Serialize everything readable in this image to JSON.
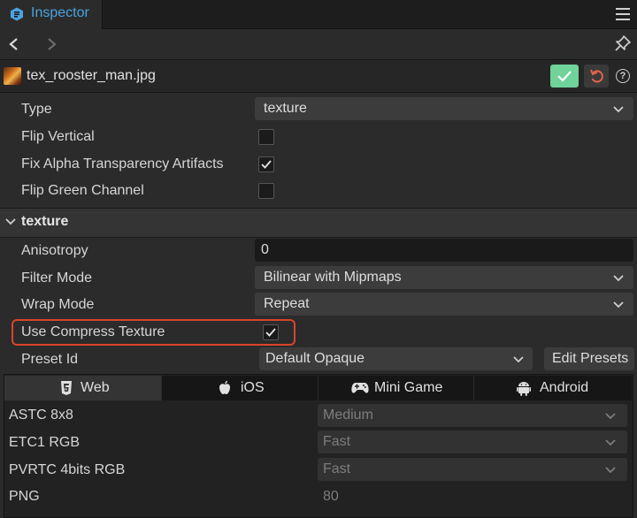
{
  "window": {
    "tab_title": "Inspector"
  },
  "file": {
    "name": "tex_rooster_man.jpg"
  },
  "import": {
    "type_label": "Type",
    "type_value": "texture",
    "flip_vertical_label": "Flip Vertical",
    "flip_vertical": false,
    "fix_alpha_label": "Fix Alpha Transparency Artifacts",
    "fix_alpha": true,
    "flip_green_label": "Flip Green Channel",
    "flip_green": false
  },
  "texture_section": {
    "title": "texture",
    "anisotropy_label": "Anisotropy",
    "anisotropy_value": "0",
    "filter_mode_label": "Filter Mode",
    "filter_mode_value": "Bilinear with Mipmaps",
    "wrap_mode_label": "Wrap Mode",
    "wrap_mode_value": "Repeat",
    "use_compress_label": "Use Compress Texture",
    "use_compress": true,
    "preset_id_label": "Preset Id",
    "preset_id_value": "Default Opaque",
    "edit_presets_label": "Edit Presets"
  },
  "platform_tabs": [
    {
      "label": "Web",
      "icon": "html5-icon",
      "active": true
    },
    {
      "label": "iOS",
      "icon": "apple-icon",
      "active": false
    },
    {
      "label": "Mini Game",
      "icon": "gamepad-icon",
      "active": false
    },
    {
      "label": "Android",
      "icon": "android-icon",
      "active": false
    }
  ],
  "web_formats": [
    {
      "label": "ASTC 8x8",
      "value": "Medium"
    },
    {
      "label": "ETC1 RGB",
      "value": "Fast"
    },
    {
      "label": "PVRTC 4bits RGB",
      "value": "Fast"
    },
    {
      "label": "PNG",
      "value": "80"
    }
  ],
  "colors": {
    "accent": "#4aa3e0",
    "apply": "#6fd39a",
    "revert": "#e0634a",
    "highlight": "#d9452b"
  }
}
